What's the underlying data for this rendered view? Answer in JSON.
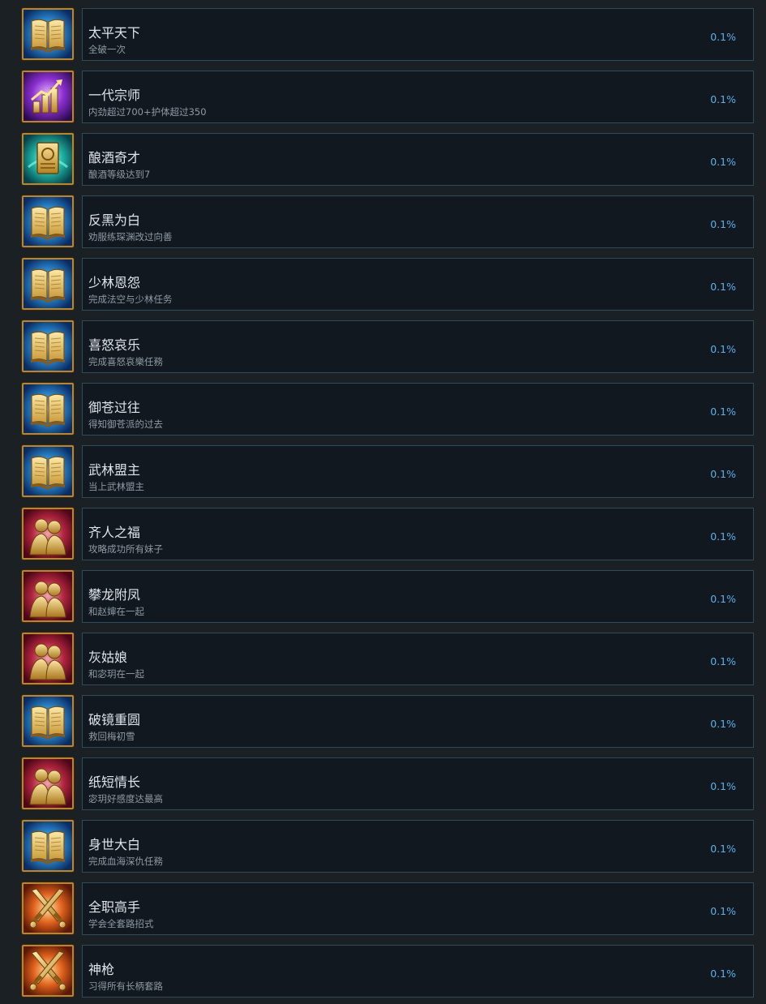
{
  "achievements": [
    {
      "title": "太平天下",
      "description": "全破一次",
      "percent": "0.1%",
      "icon": "book-icon"
    },
    {
      "title": "一代宗师",
      "description": "内劲超过700+护体超过350",
      "percent": "0.1%",
      "icon": "stats-icon"
    },
    {
      "title": "酿酒奇才",
      "description": "酿酒等级达到7",
      "percent": "0.1%",
      "icon": "wine-scroll-icon"
    },
    {
      "title": "反黑为白",
      "description": "劝服练琛渊改过向善",
      "percent": "0.1%",
      "icon": "book-icon"
    },
    {
      "title": "少林恩怨",
      "description": "完成法空与少林任务",
      "percent": "0.1%",
      "icon": "book-icon"
    },
    {
      "title": "喜怒哀乐",
      "description": "完成喜怒哀樂任務",
      "percent": "0.1%",
      "icon": "book-icon"
    },
    {
      "title": "御苍过往",
      "description": "得知御苍派的过去",
      "percent": "0.1%",
      "icon": "book-icon"
    },
    {
      "title": "武林盟主",
      "description": "当上武林盟主",
      "percent": "0.1%",
      "icon": "book-icon"
    },
    {
      "title": "齐人之福",
      "description": "攻略成功所有妹子",
      "percent": "0.1%",
      "icon": "couple-icon"
    },
    {
      "title": "攀龙附凤",
      "description": "和赵婶在一起",
      "percent": "0.1%",
      "icon": "couple-icon"
    },
    {
      "title": "灰姑娘",
      "description": "和宓玥在一起",
      "percent": "0.1%",
      "icon": "couple-icon"
    },
    {
      "title": "破镜重圆",
      "description": "救回梅初雪",
      "percent": "0.1%",
      "icon": "book-icon"
    },
    {
      "title": "纸短情长",
      "description": "宓玥好感度达最高",
      "percent": "0.1%",
      "icon": "couple-icon"
    },
    {
      "title": "身世大白",
      "description": "完成血海深仇任務",
      "percent": "0.1%",
      "icon": "book-icon"
    },
    {
      "title": "全职高手",
      "description": "学会全套路招式",
      "percent": "0.1%",
      "icon": "crossed-swords-icon"
    },
    {
      "title": "神枪",
      "description": "习得所有长柄套路",
      "percent": "0.1%",
      "icon": "crossed-swords-icon"
    }
  ]
}
